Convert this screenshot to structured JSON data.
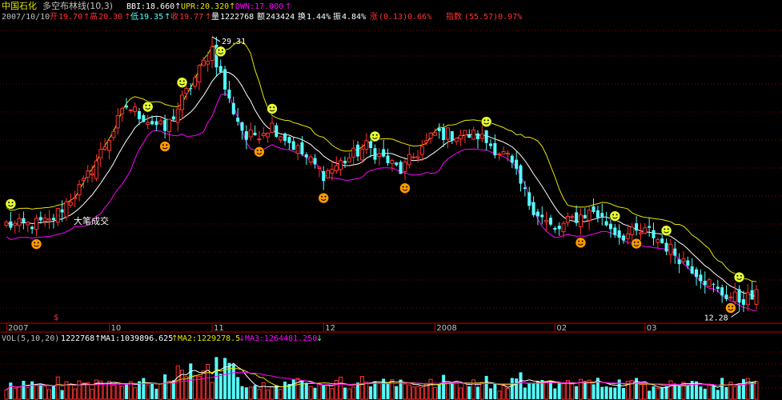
{
  "header": {
    "stock_name": "中国石化",
    "indicator_name": "多空布林线(10,3)",
    "bbi_label": "BBI:",
    "bbi_value": "18.660",
    "upr_label": "UPR:",
    "upr_value": "20.320",
    "dwn_label": "DWN:",
    "dwn_value": "17.000",
    "date": "2007/10/10",
    "open_label": "开",
    "open": "19.70",
    "high_label": "高",
    "high": "20.30",
    "low_label": "低",
    "low": "19.35",
    "close_label": "收",
    "close": "19.77",
    "vol_label": "量",
    "vol": "1222768",
    "amount_label": "额",
    "amount": "243424",
    "turnover_label": "换",
    "turnover": "1.44%",
    "amplitude_label": "振",
    "amplitude": "4.84%",
    "change_label": "涨",
    "change": "(0.13)0.66%",
    "index_label": "指数",
    "index_change": "(55.57)0.97%"
  },
  "annotations": {
    "max_price": "29.31",
    "min_price": "12.28",
    "big_trade": "大笔成交",
    "marker": "$"
  },
  "time_axis": [
    "2007",
    "10",
    "11",
    "12",
    "2008",
    "02",
    "03"
  ],
  "volume_header": {
    "label": "VOL(5,10,20)",
    "vol": "1222768",
    "ma1_label": "MA1:",
    "ma1": "1039896.625",
    "ma2_label": "MA2:",
    "ma2": "1229278.5",
    "ma3_label": "MA3:",
    "ma3": "1264481.250"
  },
  "colors": {
    "up": "#ff3232",
    "down": "#54ffff",
    "upper_band": "#e6e600",
    "middle_band": "#ffffff",
    "lower_band": "#ff00ff",
    "grid": "#840000",
    "buy_icon": "#ff9900",
    "sell_icon": "#e6ff33",
    "vol_ma1": "#ffffff",
    "vol_ma2": "#e6e600",
    "vol_ma3": "#ff00ff"
  },
  "chart_data": {
    "type": "candlestick",
    "title": "中国石化 多空布林线(10,3)",
    "ylim": [
      12.0,
      30.0
    ],
    "vol_ylim": [
      0,
      6000000
    ],
    "time_labels": [
      "2007",
      "10",
      "11",
      "12",
      "2008",
      "02",
      "03"
    ],
    "time_label_index": [
      0,
      24,
      48,
      74,
      100,
      128,
      149
    ],
    "extremes": {
      "max": 29.31,
      "min": 12.28
    },
    "key_points": [
      {
        "index": 3,
        "close": 17.6
      },
      {
        "index": 10,
        "close": 17.8
      },
      {
        "index": 18,
        "close": 20.2
      },
      {
        "index": 28,
        "close": 25.0
      },
      {
        "index": 37,
        "close": 23.5
      },
      {
        "index": 48,
        "close": 28.6
      },
      {
        "index": 52,
        "close": 25.3
      },
      {
        "index": 56,
        "close": 23.0
      },
      {
        "index": 62,
        "close": 23.8
      },
      {
        "index": 66,
        "close": 22.8
      },
      {
        "index": 74,
        "close": 20.8
      },
      {
        "index": 84,
        "close": 22.5
      },
      {
        "index": 92,
        "close": 21.0
      },
      {
        "index": 100,
        "close": 23.3
      },
      {
        "index": 110,
        "close": 23.2
      },
      {
        "index": 117,
        "close": 21.8
      },
      {
        "index": 122,
        "close": 19.0
      },
      {
        "index": 128,
        "close": 17.2
      },
      {
        "index": 132,
        "close": 18.0
      },
      {
        "index": 137,
        "close": 18.5
      },
      {
        "index": 143,
        "close": 17.0
      },
      {
        "index": 150,
        "close": 17.2
      },
      {
        "index": 160,
        "close": 15.0
      },
      {
        "index": 166,
        "close": 13.5
      },
      {
        "index": 171,
        "close": 13.0
      },
      {
        "index": 175,
        "close": 13.2
      }
    ],
    "signals": [
      {
        "type": "sell",
        "index": 1
      },
      {
        "type": "buy",
        "index": 7
      },
      {
        "type": "sell",
        "index": 33
      },
      {
        "type": "buy",
        "index": 37
      },
      {
        "type": "sell",
        "index": 41
      },
      {
        "type": "sell",
        "index": 50
      },
      {
        "type": "buy",
        "index": 59
      },
      {
        "type": "sell",
        "index": 62
      },
      {
        "type": "buy",
        "index": 74
      },
      {
        "type": "sell",
        "index": 86
      },
      {
        "type": "buy",
        "index": 93
      },
      {
        "type": "sell",
        "index": 112
      },
      {
        "type": "buy",
        "index": 134
      },
      {
        "type": "sell",
        "index": 142
      },
      {
        "type": "buy",
        "index": 147
      },
      {
        "type": "sell",
        "index": 154
      },
      {
        "type": "buy",
        "index": 169
      },
      {
        "type": "sell",
        "index": 171
      }
    ]
  }
}
